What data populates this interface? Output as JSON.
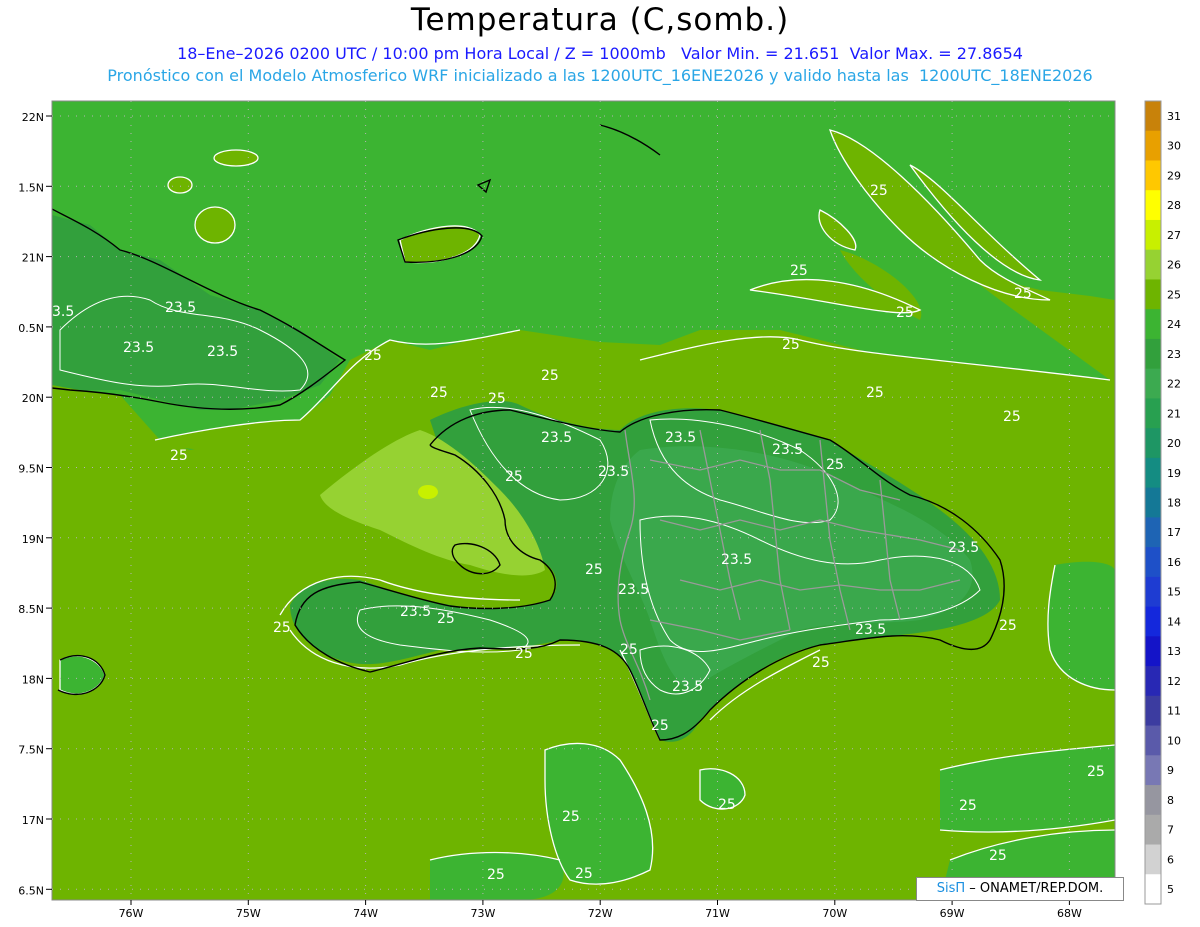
{
  "header": {
    "title": "Temperatura (C,somb.)",
    "line1": "18–Ene–2026 0200 UTC / 10:00 pm Hora Local / Z = 1000mb   Valor Min. = 21.651  Valor Max. = 27.8654",
    "line2": "Pronóstico con el Modelo Atmosferico WRF inicializado a las 1200UTC_16ENE2026 y valido hasta las  1200UTC_18ENE2026"
  },
  "axes": {
    "lat_labels": [
      "22N",
      "1.5N",
      "21N",
      "0.5N",
      "20N",
      "9.5N",
      "19N",
      "8.5N",
      "18N",
      "7.5N",
      "17N",
      "6.5N"
    ],
    "lon_labels": [
      "76W",
      "75W",
      "74W",
      "73W",
      "72W",
      "71W",
      "70W",
      "69W",
      "68W"
    ]
  },
  "colorbar": {
    "labels": [
      "31",
      "30",
      "29",
      "28",
      "27",
      "26",
      "25",
      "24",
      "23",
      "22",
      "21",
      "20",
      "19",
      "18",
      "17",
      "16",
      "15",
      "14",
      "13",
      "12",
      "11",
      "10",
      "9",
      "8",
      "7",
      "6",
      "5"
    ],
    "colors": [
      "#c8820a",
      "#e8a000",
      "#ffc800",
      "#ffff00",
      "#c8f000",
      "#96d232",
      "#6eb400",
      "#3cb432",
      "#32a03c",
      "#3caa50",
      "#28a050",
      "#1e9664",
      "#148c82",
      "#147896",
      "#1e64b4",
      "#1e50c8",
      "#1e3cd2",
      "#1428dc",
      "#1414c8",
      "#2828b4",
      "#3c3ca0",
      "#5a5aaa",
      "#7878b4",
      "#9696a0",
      "#aaaaaa",
      "#d2d2d2",
      "#ffffff"
    ]
  },
  "contour_labels": {
    "c25": "25",
    "c235": "23.5",
    "c35": "3.5"
  },
  "credit": {
    "sis": "SisΠ",
    "rest": " – ONAMET/REP.DOM."
  },
  "colors": {
    "field_green": "#6eb400",
    "land_green": "#3cb432",
    "dark_green": "#32a03c",
    "light_green": "#96d232",
    "coast": "#000000",
    "border_gray": "#9a9a9a",
    "contour_white": "#ffffff"
  }
}
